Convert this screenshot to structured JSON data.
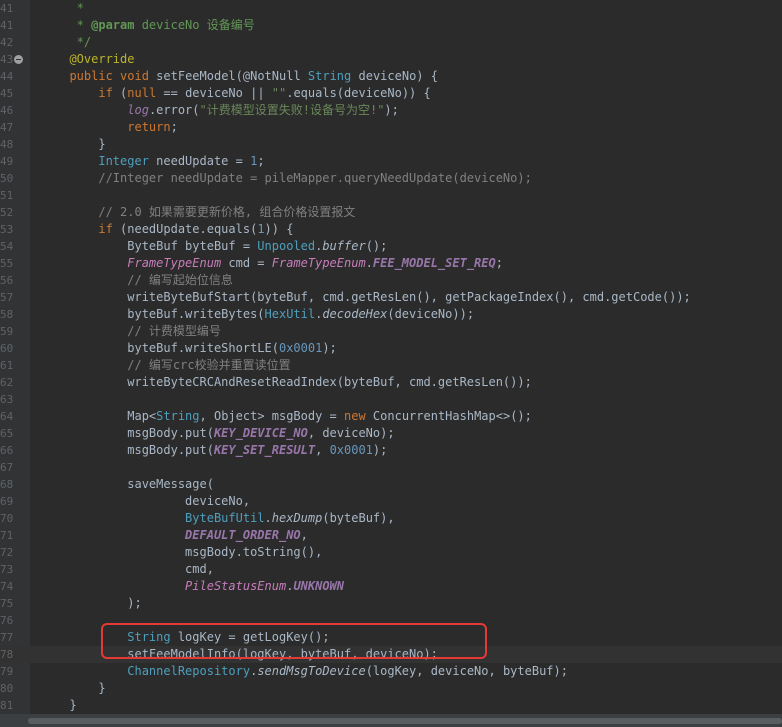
{
  "editor": {
    "lines": [
      {
        "n": "41",
        "t": "   *"
      },
      {
        "n": "41",
        "t": "   * @param deviceNo 设备编号"
      },
      {
        "n": "42",
        "t": "   */"
      },
      {
        "n": "43",
        "t": "  @Override"
      },
      {
        "n": "44",
        "t": "  public void setFeeModel(@NotNull String deviceNo) {"
      },
      {
        "n": "45",
        "t": "      if (null == deviceNo || \"\".equals(deviceNo)) {"
      },
      {
        "n": "46",
        "t": "          log.error(\"计费模型设置失败!设备号为空!\");"
      },
      {
        "n": "47",
        "t": "          return;"
      },
      {
        "n": "48",
        "t": "      }"
      },
      {
        "n": "49",
        "t": "      Integer needUpdate = 1;"
      },
      {
        "n": "50",
        "t": "      //Integer needUpdate = pileMapper.queryNeedUpdate(deviceNo);"
      },
      {
        "n": "51",
        "t": ""
      },
      {
        "n": "52",
        "t": "      // 2.0 如果需要更新价格, 组合价格设置报文"
      },
      {
        "n": "53",
        "t": "      if (needUpdate.equals(1)) {"
      },
      {
        "n": "54",
        "t": "          ByteBuf byteBuf = Unpooled.buffer();"
      },
      {
        "n": "55",
        "t": "          FrameTypeEnum cmd = FrameTypeEnum.FEE_MODEL_SET_REQ;"
      },
      {
        "n": "56",
        "t": "          // 编写起始位信息"
      },
      {
        "n": "57",
        "t": "          writeByteBufStart(byteBuf, cmd.getResLen(), getPackageIndex(), cmd.getCode());"
      },
      {
        "n": "58",
        "t": "          byteBuf.writeBytes(HexUtil.decodeHex(deviceNo));"
      },
      {
        "n": "59",
        "t": "          // 计费模型编号"
      },
      {
        "n": "60",
        "t": "          byteBuf.writeShortLE(0x0001);"
      },
      {
        "n": "61",
        "t": "          // 编写crc校验并重置读位置"
      },
      {
        "n": "62",
        "t": "          writeByteCRCAndResetReadIndex(byteBuf, cmd.getResLen());"
      },
      {
        "n": "63",
        "t": ""
      },
      {
        "n": "64",
        "t": "          Map<String, Object> msgBody = new ConcurrentHashMap<>();"
      },
      {
        "n": "65",
        "t": "          msgBody.put(KEY_DEVICE_NO, deviceNo);"
      },
      {
        "n": "66",
        "t": "          msgBody.put(KEY_SET_RESULT, 0x0001);"
      },
      {
        "n": "67",
        "t": ""
      },
      {
        "n": "68",
        "t": "          saveMessage("
      },
      {
        "n": "69",
        "t": "                  deviceNo,"
      },
      {
        "n": "70",
        "t": "                  ByteBufUtil.hexDump(byteBuf),"
      },
      {
        "n": "71",
        "t": "                  DEFAULT_ORDER_NO,"
      },
      {
        "n": "72",
        "t": "                  msgBody.toString(),"
      },
      {
        "n": "73",
        "t": "                  cmd,"
      },
      {
        "n": "74",
        "t": "                  PileStatusEnum.UNKNOWN"
      },
      {
        "n": "75",
        "t": "          );"
      },
      {
        "n": "76",
        "t": ""
      },
      {
        "n": "77",
        "t": "          String logKey = getLogKey();"
      },
      {
        "n": "78",
        "t": "          setFeeModelInfo(logKey, byteBuf, deviceNo);"
      },
      {
        "n": "79",
        "t": "          ChannelRepository.sendMsgToDevice(logKey, deviceNo, byteBuf);"
      },
      {
        "n": "80",
        "t": "      }"
      },
      {
        "n": "81",
        "t": "  }"
      }
    ]
  },
  "colors": {
    "background": "#2b2b2b",
    "gutter": "#313335",
    "highlight_box": "#e53935"
  }
}
